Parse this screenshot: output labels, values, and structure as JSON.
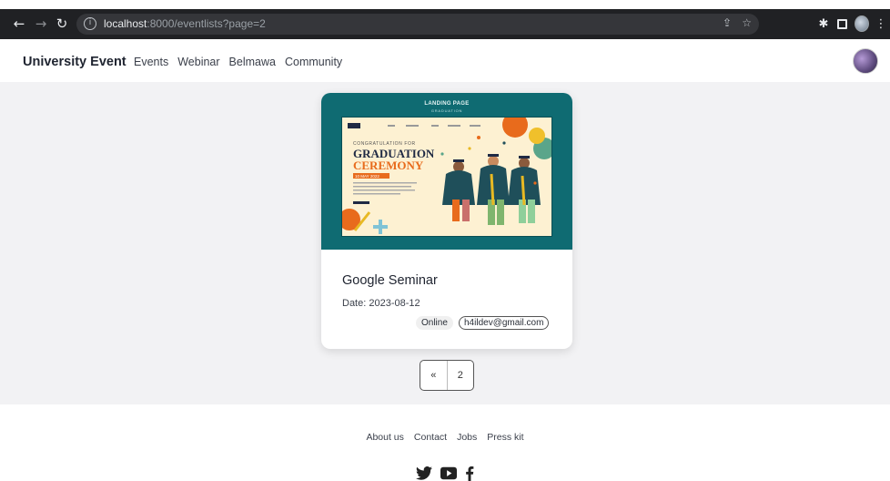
{
  "browser": {
    "url_host": "localhost",
    "url_rest": ":8000/eventlists?page=2",
    "icons": [
      "back-arrow-icon",
      "forward-arrow-icon",
      "reload-icon",
      "info-icon",
      "share-icon",
      "star-icon",
      "extensions-icon",
      "side-panel-icon",
      "profile-icon",
      "menu-icon"
    ]
  },
  "navbar": {
    "brand": "University Event",
    "links": [
      "Events",
      "Webinar",
      "Belmawa",
      "Community"
    ]
  },
  "event_card": {
    "banner_title": "LANDING PAGE",
    "banner_subtitle": "GRADUATION",
    "poster": {
      "kicker": "CONGRATULATION FOR",
      "headline_1": "GRADUATION",
      "headline_2": "CEREMONY",
      "date_badge": "10 MAY 2022"
    },
    "title": "Google Seminar",
    "date": "Date: 2023-08-12",
    "mode": "Online",
    "contact": "h4ildev@gmail.com"
  },
  "pagination": {
    "prev_label": "«",
    "page_label": "2"
  },
  "footer": {
    "links": [
      "About us",
      "Contact",
      "Jobs",
      "Press kit"
    ],
    "social_icons": [
      "twitter-icon",
      "youtube-icon",
      "facebook-icon"
    ]
  },
  "colors": {
    "chrome_bar": "#202124",
    "banner_teal": "#0f6b72",
    "page_background": "#f2f2f4",
    "poster_cream": "#fdf1d2",
    "poster_orange": "#e86b1c"
  }
}
